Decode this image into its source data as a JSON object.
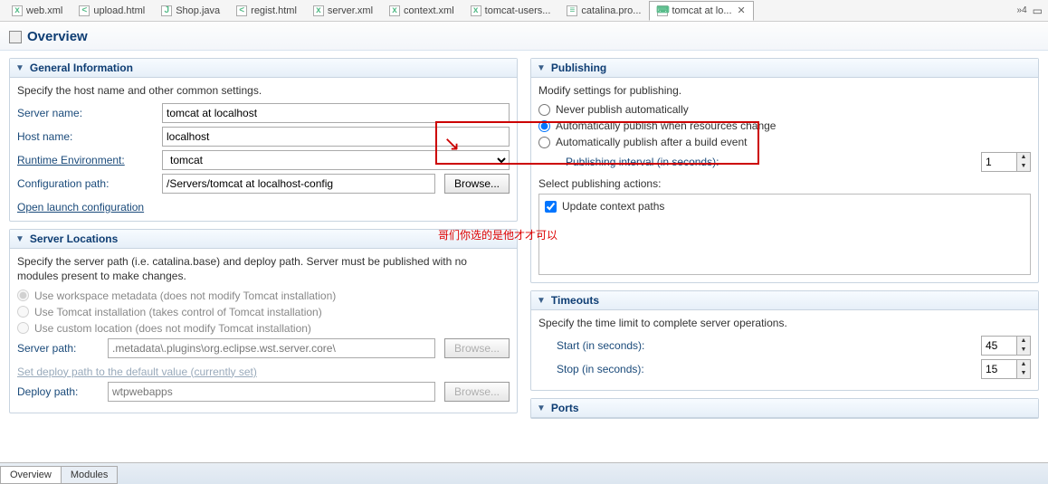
{
  "tabs": {
    "items": [
      {
        "label": "web.xml"
      },
      {
        "label": "upload.html"
      },
      {
        "label": "Shop.java"
      },
      {
        "label": "regist.html"
      },
      {
        "label": "server.xml"
      },
      {
        "label": "context.xml"
      },
      {
        "label": "tomcat-users..."
      },
      {
        "label": "catalina.pro..."
      },
      {
        "label": "tomcat at lo..."
      }
    ],
    "overflow": "»4"
  },
  "page_title": "Overview",
  "general": {
    "title": "General Information",
    "desc": "Specify the host name and other common settings.",
    "server_name_lbl": "Server name:",
    "server_name_val": "tomcat at localhost",
    "host_name_lbl": "Host name:",
    "host_name_val": "localhost",
    "runtime_env_lbl": "Runtime Environment:",
    "runtime_env_val": "tomcat",
    "config_path_lbl": "Configuration path:",
    "config_path_val": "/Servers/tomcat at localhost-config",
    "browse_btn": "Browse...",
    "open_launch_link": "Open launch configuration"
  },
  "server_locations": {
    "title": "Server Locations",
    "desc": "Specify the server path (i.e. catalina.base) and deploy path. Server must be published with no modules present to make changes.",
    "opt1": "Use workspace metadata (does not modify Tomcat installation)",
    "opt2": "Use Tomcat installation (takes control of Tomcat installation)",
    "opt3": "Use custom location (does not modify Tomcat installation)",
    "server_path_lbl": "Server path:",
    "server_path_val": ".metadata\\.plugins\\org.eclipse.wst.server.core\\",
    "set_default_link": "Set deploy path to the default value (currently set)",
    "deploy_path_lbl": "Deploy path:",
    "deploy_path_val": "wtpwebapps",
    "browse_btn": "Browse..."
  },
  "publishing": {
    "title": "Publishing",
    "desc": "Modify settings for publishing.",
    "opt1": "Never publish automatically",
    "opt2": "Automatically publish when resources change",
    "opt3": "Automatically publish after a build event",
    "interval_lbl": "Publishing interval (in seconds):",
    "interval_val": "1",
    "actions_lbl": "Select publishing actions:",
    "update_ctx": "Update context paths"
  },
  "annotation_text": "哥们你选的是他才才可以",
  "timeouts": {
    "title": "Timeouts",
    "desc": "Specify the time limit to complete server operations.",
    "start_lbl": "Start (in seconds):",
    "start_val": "45",
    "stop_lbl": "Stop (in seconds):",
    "stop_val": "15"
  },
  "ports": {
    "title": "Ports"
  },
  "bottom_tabs": {
    "overview": "Overview",
    "modules": "Modules"
  }
}
